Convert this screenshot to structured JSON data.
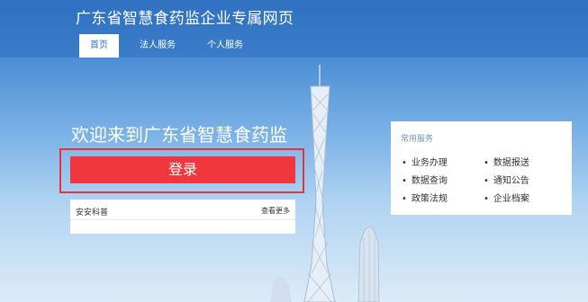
{
  "header": {
    "site_title": "广东省智慧食药监企业专属网页",
    "nav": [
      {
        "label": "首页",
        "active": true
      },
      {
        "label": "法人服务",
        "active": false
      },
      {
        "label": "个人服务",
        "active": false
      }
    ]
  },
  "hero": {
    "welcome": "欢迎来到广东省智慧食药监",
    "login_label": "登录"
  },
  "news": {
    "title": "安安科普",
    "more": "查看更多"
  },
  "services": {
    "title": "常用服务",
    "items": [
      "业务办理",
      "数据报送",
      "数据查询",
      "通知公告",
      "政策法规",
      "企业档案"
    ]
  },
  "colors": {
    "header": "#2f71c0",
    "login": "#f0373d",
    "login_frame": "#e5333a"
  }
}
